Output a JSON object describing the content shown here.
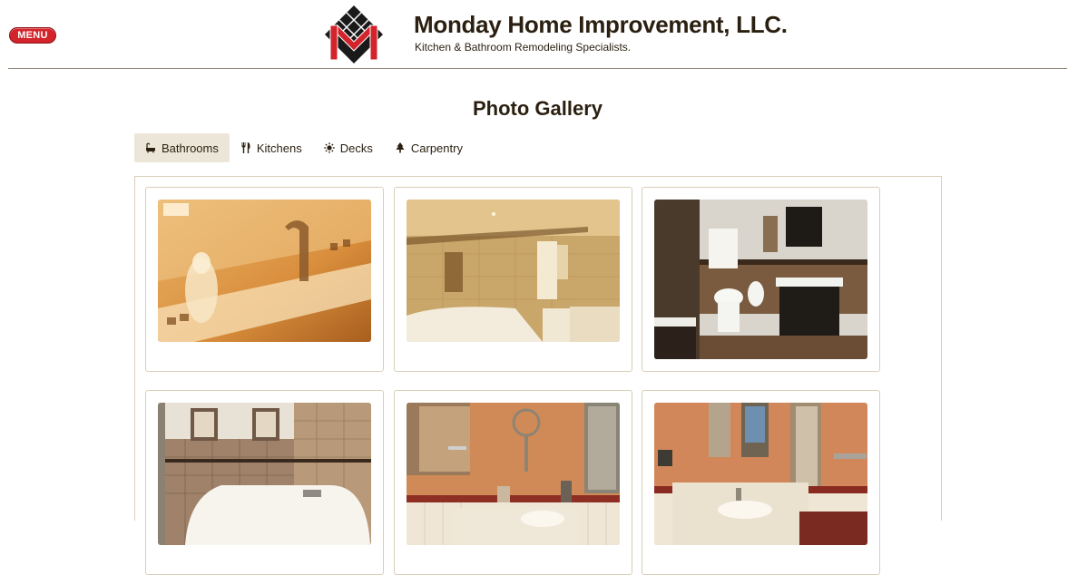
{
  "header": {
    "menu_label": "MENU",
    "title": "Monday Home Improvement, LLC.",
    "tagline": "Kitchen & Bathroom Remodeling Specialists."
  },
  "main": {
    "page_title": "Photo Gallery",
    "tabs": [
      {
        "label": "Bathrooms",
        "icon": "bathtub-icon",
        "active": true
      },
      {
        "label": "Kitchens",
        "icon": "fork-knife-icon",
        "active": false
      },
      {
        "label": "Decks",
        "icon": "sun-icon",
        "active": false
      },
      {
        "label": "Carpentry",
        "icon": "tree-icon",
        "active": false
      }
    ]
  },
  "colors": {
    "brand_red": "#d3232b",
    "logo_dark": "#1a1a1a",
    "text_dark": "#2a1f10",
    "active_tab_bg": "#ece6d8",
    "border": "#d8cfb8"
  }
}
